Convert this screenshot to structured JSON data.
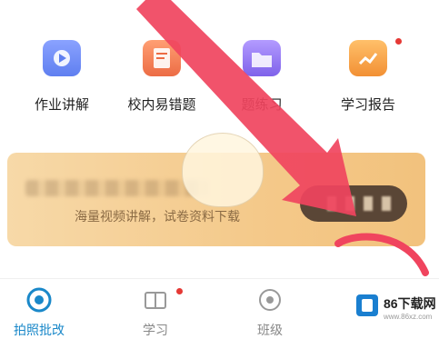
{
  "grid": {
    "items": [
      {
        "label": "作业讲解",
        "icon": "video-play-icon",
        "color": "#6f8cf5"
      },
      {
        "label": "校内易错题",
        "icon": "book-icon",
        "color": "#f08a5d"
      },
      {
        "label": "题练习",
        "icon": "folder-icon",
        "color": "#9b7cf0"
      },
      {
        "label": "学习报告",
        "icon": "report-icon",
        "color": "#f5a14a"
      }
    ]
  },
  "banner": {
    "subtitle": "海量视频讲解，试卷资料下载"
  },
  "tabbar": {
    "tabs": [
      {
        "label": "拍照批改",
        "icon": "camera-icon"
      },
      {
        "label": "学习",
        "icon": "book-open-icon"
      },
      {
        "label": "班级",
        "icon": "class-icon"
      }
    ]
  },
  "watermark": {
    "brand": "86下载网",
    "url": "www.86xz.com"
  },
  "colors": {
    "accent": "#1a88c9",
    "banner": "#f4c98a",
    "arrow": "#f0445e"
  }
}
